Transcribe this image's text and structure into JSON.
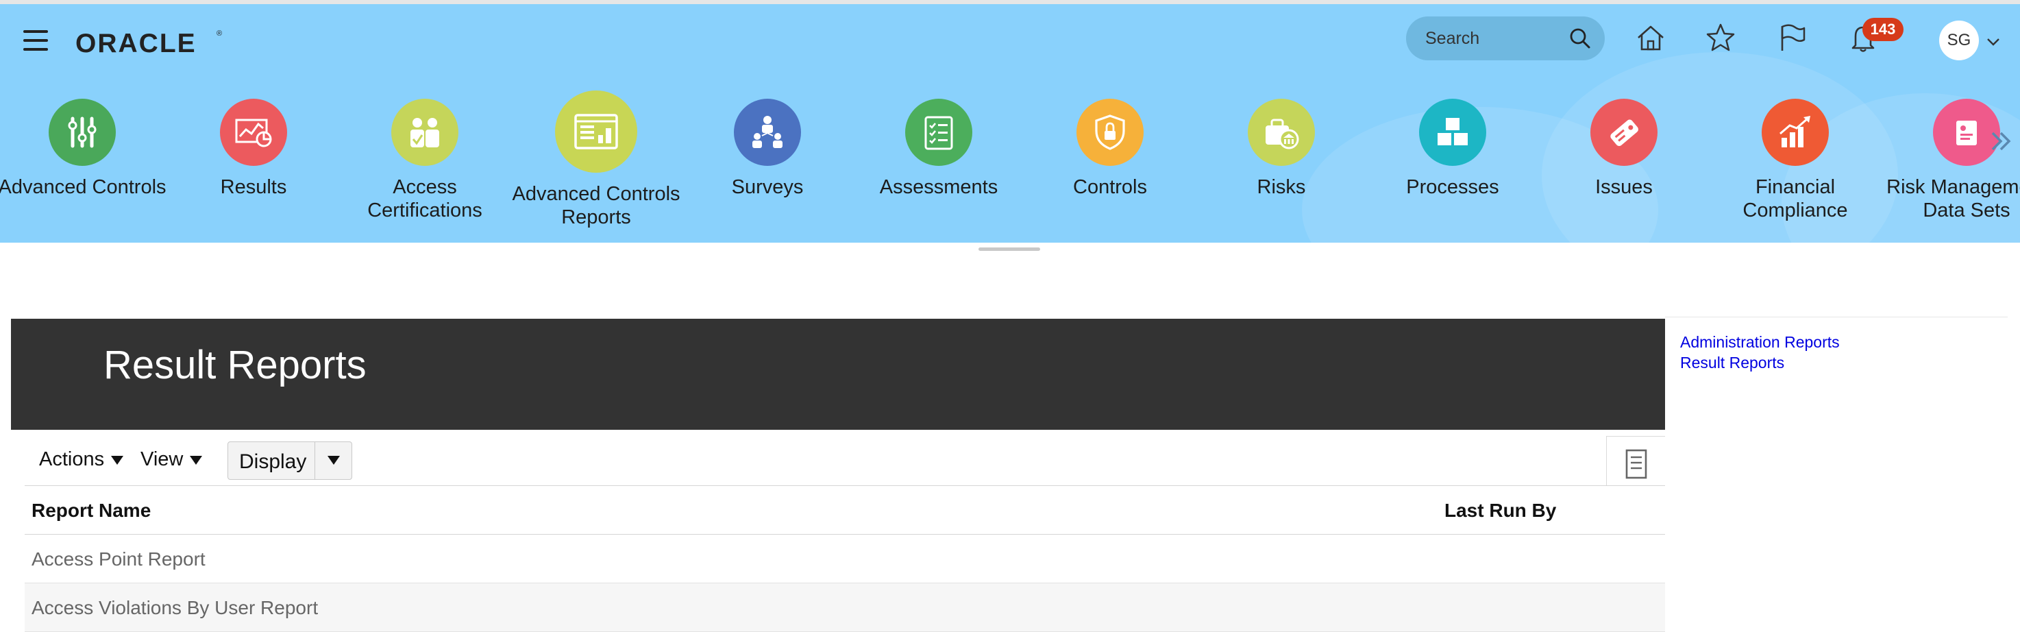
{
  "header": {
    "brand": "ORACLE",
    "search": {
      "placeholder": "Search",
      "value": ""
    },
    "notifications_count": "143",
    "user_initials": "SG"
  },
  "apps": [
    {
      "label": "Advanced Controls",
      "icon": "sliders-icon",
      "color": "#4aa85a"
    },
    {
      "label": "Results",
      "icon": "results-chart-icon",
      "color": "#ec5a5e"
    },
    {
      "label": "Access Certifications",
      "icon": "people-check-icon",
      "color": "#c5d55a"
    },
    {
      "label": "Advanced Controls Reports",
      "icon": "report-dashboard-icon",
      "color": "#c8d655"
    },
    {
      "label": "Surveys",
      "icon": "survey-people-icon",
      "color": "#4b72c1"
    },
    {
      "label": "Assessments",
      "icon": "checklist-icon",
      "color": "#4cae5c"
    },
    {
      "label": "Controls",
      "icon": "shield-lock-icon",
      "color": "#f6b13a"
    },
    {
      "label": "Risks",
      "icon": "risk-bank-icon",
      "color": "#c5d55a"
    },
    {
      "label": "Processes",
      "icon": "boxes-icon",
      "color": "#1db6c5"
    },
    {
      "label": "Issues",
      "icon": "tag-issue-icon",
      "color": "#ec5a5e"
    },
    {
      "label": "Financial Compliance",
      "icon": "growth-chart-icon",
      "color": "#ef5a34"
    },
    {
      "label": "Risk Management Data Sets",
      "icon": "data-set-icon",
      "color": "#ef5a8b"
    }
  ],
  "page": {
    "title": "Result Reports"
  },
  "toolbar": {
    "actions": "Actions",
    "view": "View",
    "display": "Display"
  },
  "table": {
    "columns": [
      "Report Name",
      "Last Run By"
    ],
    "rows": [
      {
        "name": "Access Point Report",
        "last_run_by": ""
      },
      {
        "name": "Access Violations By User Report",
        "last_run_by": ""
      }
    ]
  },
  "side_links": [
    "Administration Reports",
    "Result Reports"
  ]
}
